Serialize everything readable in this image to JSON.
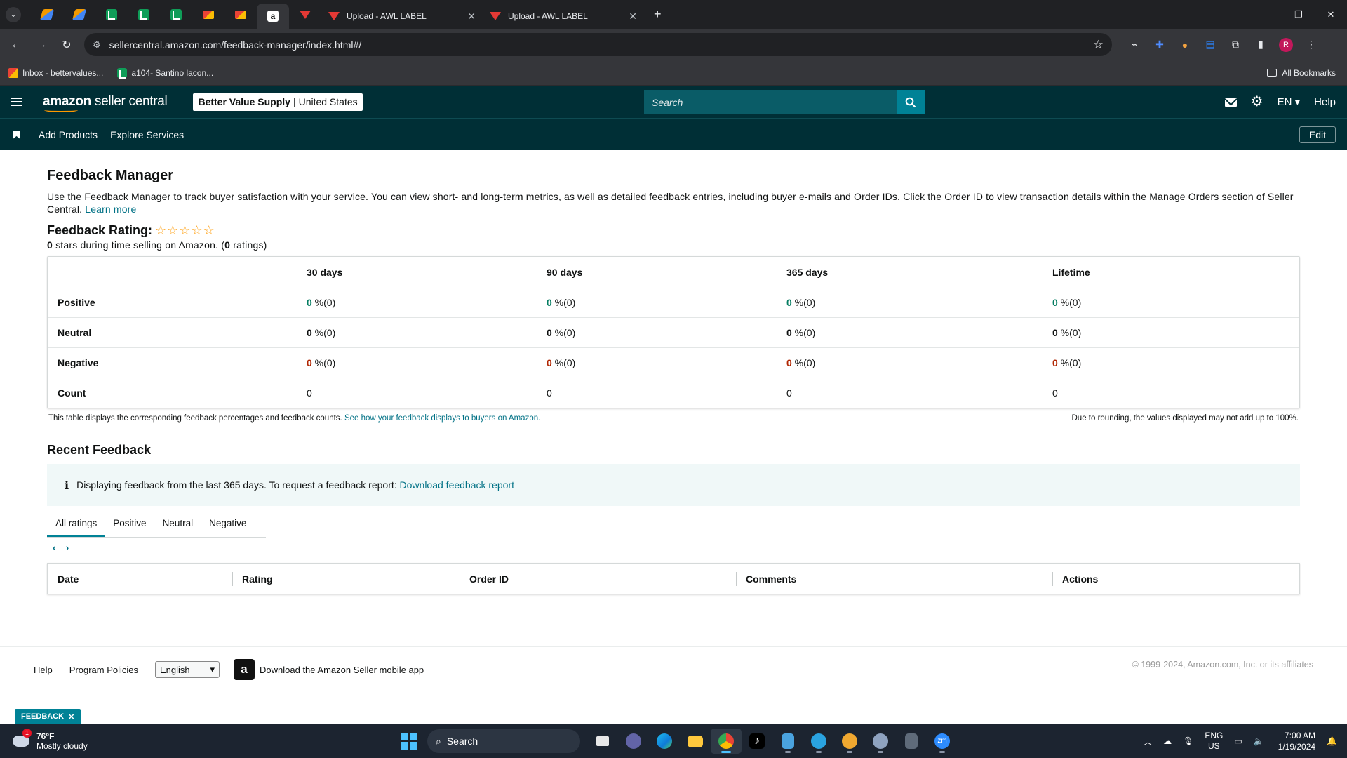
{
  "browser": {
    "tabs": [
      {
        "title": "Upload - AWL LABEL"
      },
      {
        "title": "Upload - AWL LABEL"
      }
    ],
    "url": "sellercentral.amazon.com/feedback-manager/index.html#/",
    "bookmarks": [
      {
        "label": "Inbox - bettervalues..."
      },
      {
        "label": "a104- Santino lacon..."
      }
    ],
    "all_bookmarks": "All Bookmarks",
    "profile_initial": "R"
  },
  "header": {
    "logo_bold": "amazon",
    "logo_rest": " seller central",
    "store_name": "Better Value Supply",
    "store_sep": "|",
    "marketplace": "United States",
    "search_placeholder": "Search",
    "lang": "EN",
    "help": "Help",
    "nav": [
      "Add Products",
      "Explore Services"
    ],
    "edit": "Edit"
  },
  "page": {
    "title": "Feedback Manager",
    "intro": "Use the Feedback Manager to track buyer satisfaction with your service. You can view short- and long-term metrics, as well as detailed feedback entries, including buyer e-mails and Order IDs. Click the Order ID to view transaction details within the Manage Orders section of Seller Central.",
    "learn_more": "Learn more",
    "rating_label": "Feedback Rating:",
    "stars_value": "0",
    "stars_text": " stars during time selling on Amazon. (",
    "ratings_count": "0",
    "ratings_text": " ratings)",
    "star_rating": {
      "value": 0,
      "max": 5
    },
    "metrics": {
      "columns": [
        "30 days",
        "90 days",
        "365 days",
        "Lifetime"
      ],
      "rows": [
        {
          "label": "Positive",
          "kind": "pos",
          "cells": [
            {
              "v": "0",
              "s": " %(0)"
            },
            {
              "v": "0",
              "s": " %(0)"
            },
            {
              "v": "0",
              "s": " %(0)"
            },
            {
              "v": "0",
              "s": " %(0)"
            }
          ]
        },
        {
          "label": "Neutral",
          "kind": "neu",
          "cells": [
            {
              "v": "0",
              "s": " %(0)"
            },
            {
              "v": "0",
              "s": " %(0)"
            },
            {
              "v": "0",
              "s": " %(0)"
            },
            {
              "v": "0",
              "s": " %(0)"
            }
          ]
        },
        {
          "label": "Negative",
          "kind": "neg",
          "cells": [
            {
              "v": "0",
              "s": " %(0)"
            },
            {
              "v": "0",
              "s": " %(0)"
            },
            {
              "v": "0",
              "s": " %(0)"
            },
            {
              "v": "0",
              "s": " %(0)"
            }
          ]
        },
        {
          "label": "Count",
          "kind": "count",
          "cells": [
            {
              "v": "0",
              "s": ""
            },
            {
              "v": "0",
              "s": ""
            },
            {
              "v": "0",
              "s": ""
            },
            {
              "v": "0",
              "s": ""
            }
          ]
        }
      ]
    },
    "note_left": "This table displays the corresponding feedback percentages and feedback counts.",
    "note_link": "See how your feedback displays to buyers on Amazon.",
    "note_right": "Due to rounding, the values displayed may not add up to 100%.",
    "recent_title": "Recent Feedback",
    "info_text": "Displaying feedback from the last 365 days. To request a feedback report:",
    "info_link": "Download feedback report",
    "filter_tabs": [
      "All ratings",
      "Positive",
      "Neutral",
      "Negative"
    ],
    "recent_columns": [
      "Date",
      "Rating",
      "Order ID",
      "Comments",
      "Actions"
    ]
  },
  "footer": {
    "help": "Help",
    "policies": "Program Policies",
    "language": "English",
    "app_text": "Download the Amazon Seller mobile app",
    "copyright": "© 1999-2024, Amazon.com, Inc. or its affiliates",
    "feedback_tab": "FEEDBACK"
  },
  "taskbar": {
    "weather_badge": "1",
    "temp": "76°F",
    "condition": "Mostly cloudy",
    "search": "Search",
    "lang_top": "ENG",
    "lang_bottom": "US",
    "time": "7:00 AM",
    "date": "1/19/2024"
  },
  "colors": {
    "header_bg": "#002f36",
    "link": "#007185",
    "positive": "#067d62",
    "negative": "#b12704",
    "star": "#ffa41c"
  }
}
